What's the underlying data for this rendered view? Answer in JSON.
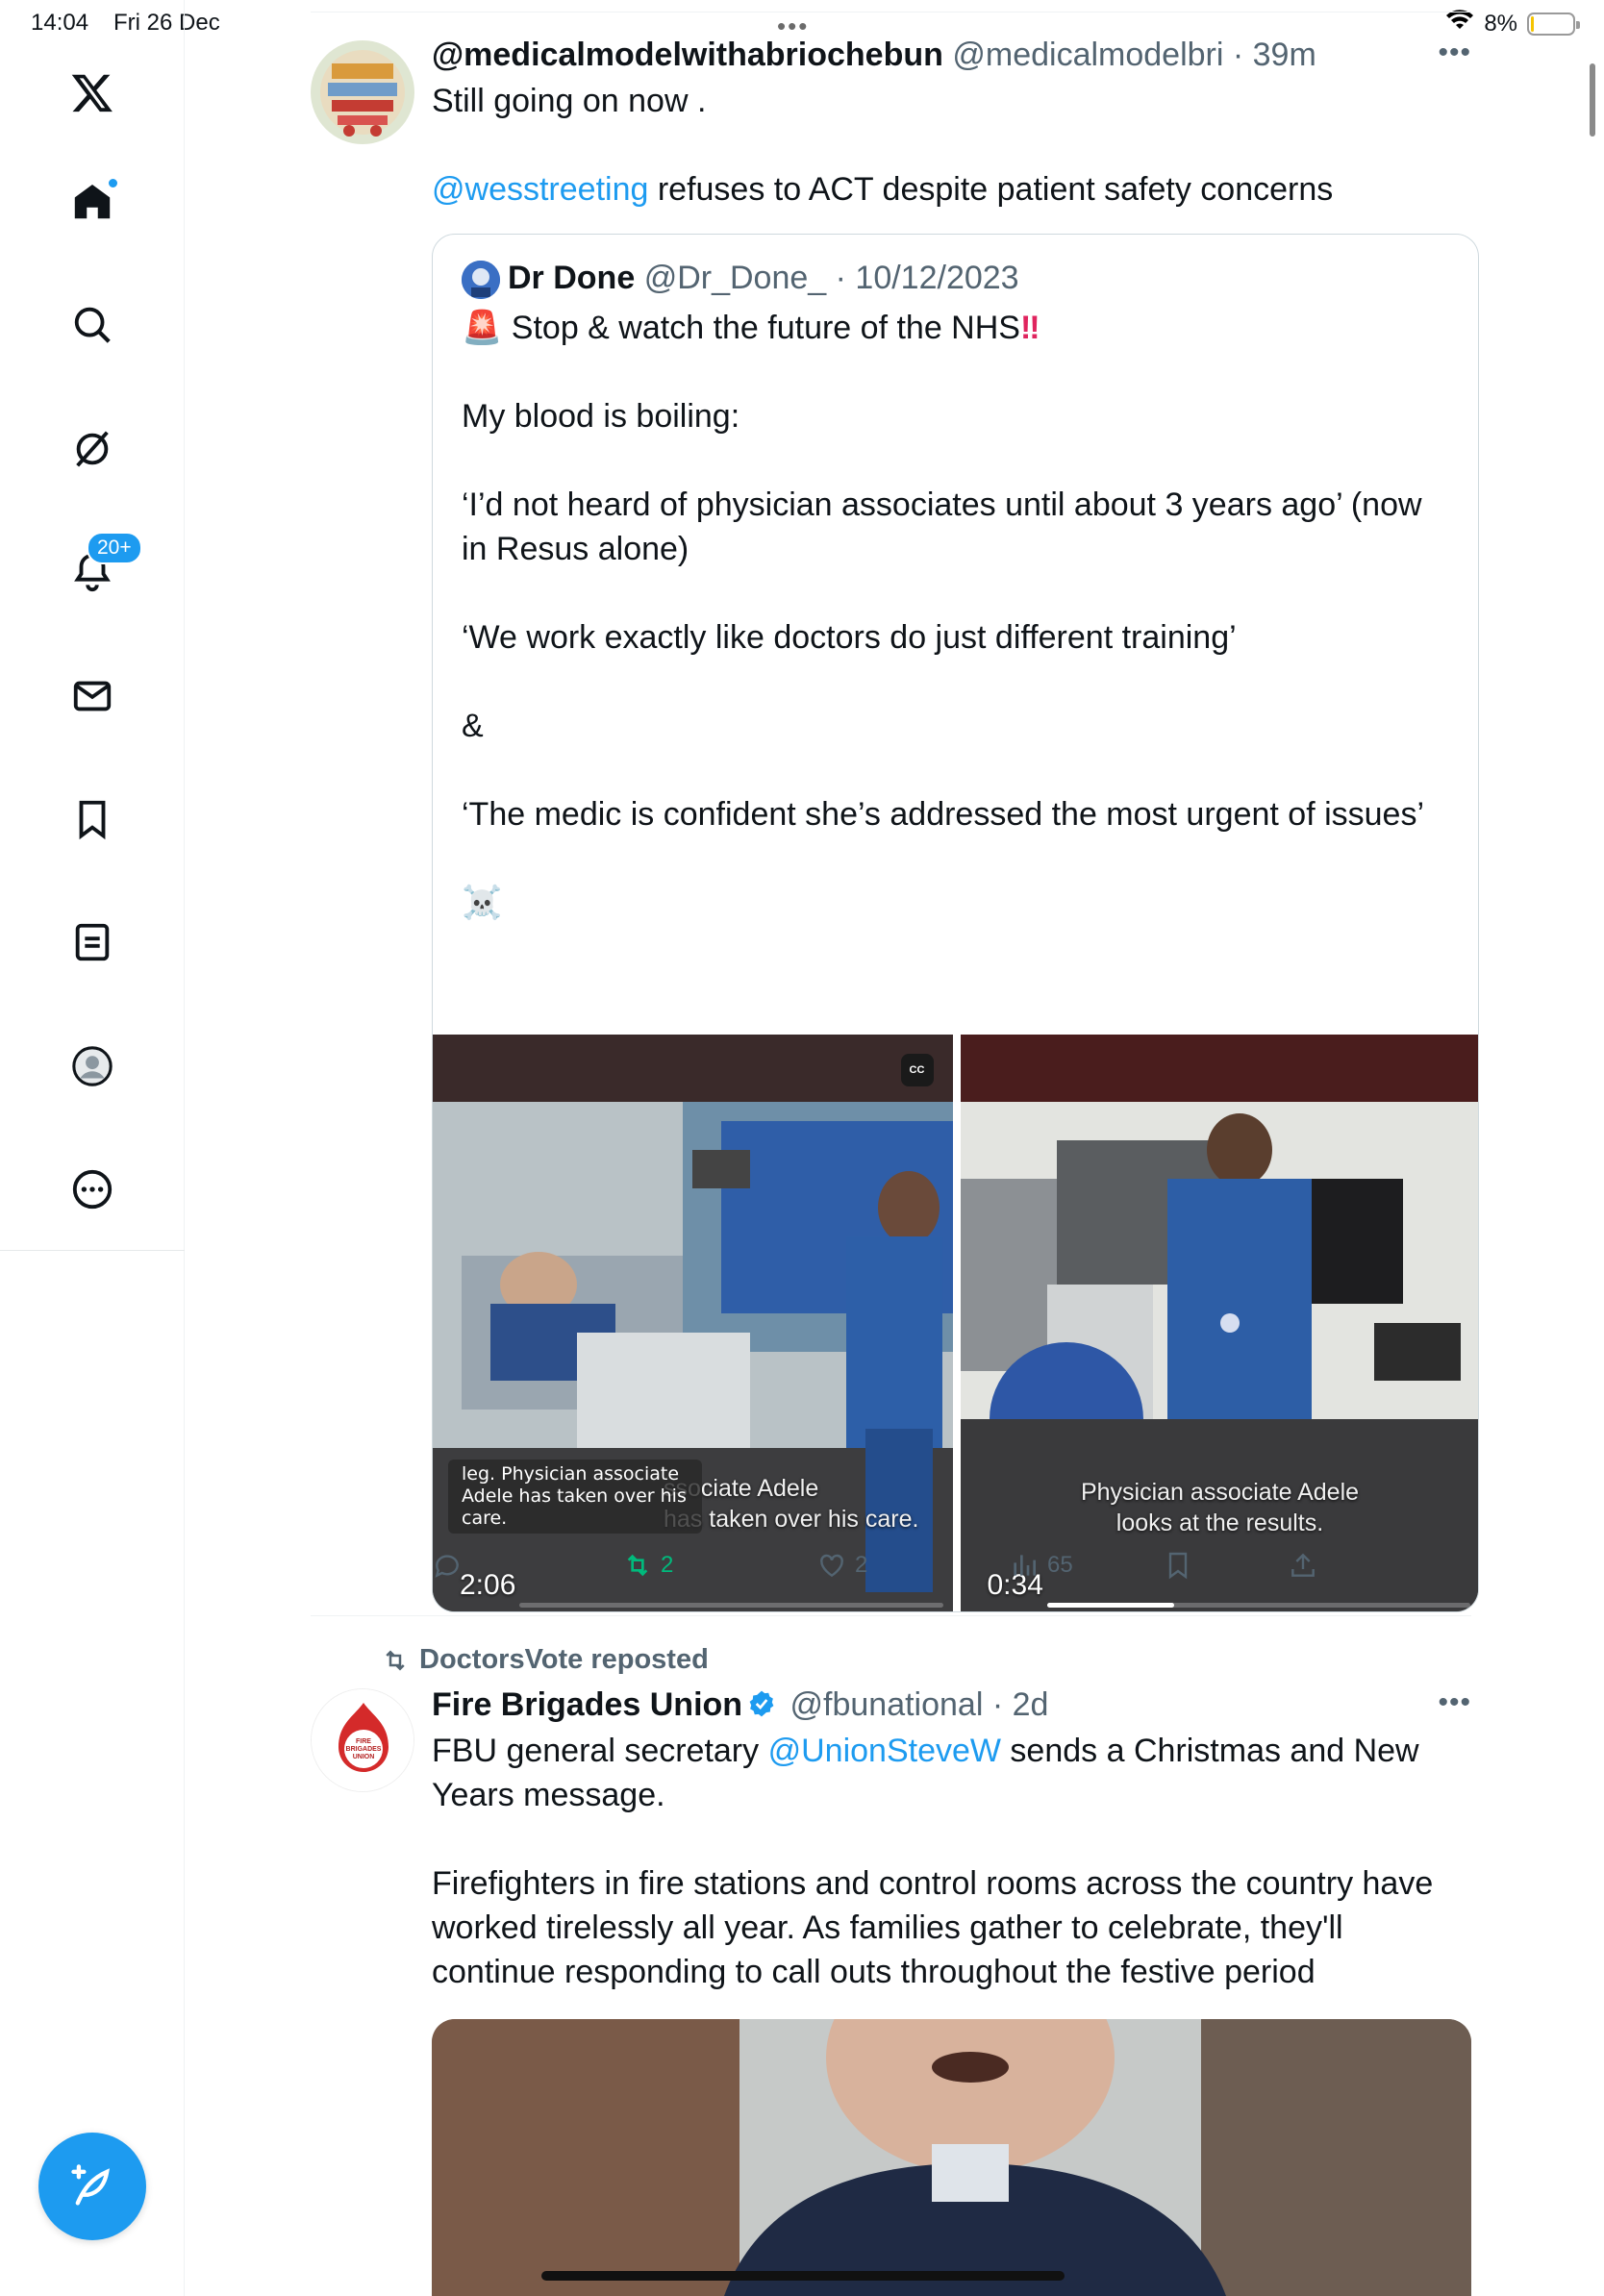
{
  "status": {
    "time": "14:04",
    "date": "Fri 26 Dec",
    "battery": "8%",
    "battery_level": 0.08,
    "multitask_dots": "•••"
  },
  "sidebar": {
    "items": [
      {
        "name": "x-logo-icon"
      },
      {
        "name": "home-icon",
        "has_dot": true
      },
      {
        "name": "search-icon"
      },
      {
        "name": "grok-icon"
      },
      {
        "name": "notifications-icon",
        "badge": "20+"
      },
      {
        "name": "messages-icon"
      },
      {
        "name": "bookmarks-icon"
      },
      {
        "name": "lists-icon"
      },
      {
        "name": "profile-icon"
      },
      {
        "name": "more-icon"
      }
    ],
    "compose_icon": "compose-feather-icon"
  },
  "tweet1": {
    "display_name": "@medicalmodelwithabriochebun",
    "handle": "@medicalmodelbri",
    "time": "· 39m",
    "text_line1": "Still going on now .",
    "mention": "@wesstreeting",
    "text_rest": " refuses to ACT despite patient safety concerns",
    "quote": {
      "name": "Dr Done",
      "handle": "@Dr_Done_",
      "date": "· 10/12/2023",
      "emoji_siren": "🚨",
      "emoji_bang": "‼",
      "line1": " Stop & watch the future of the NHS",
      "text": "My blood is boiling:\n\n‘I’d not heard of physician associates until about 3 years ago’ (now in Resus alone)\n\n‘We work exactly like doctors do just different training’\n\n&\n\n‘The medic is confident she’s addressed the most urgent of issues’\n\n☠️",
      "media": [
        {
          "duration": "2:06",
          "caption": "leg. Physician associate Adele has taken over his care.",
          "burned_sub_1": "ssociate Adele",
          "burned_sub_2": "has taken over his care.",
          "cc": "CC",
          "progress": 0.0
        },
        {
          "duration": "0:34",
          "burned_sub_1": "Physician associate Adele",
          "burned_sub_2": "looks at the results.",
          "progress": 0.3
        }
      ]
    },
    "actions": {
      "reply": "",
      "retweet": "2",
      "like": "2",
      "views": "65"
    },
    "colors": {
      "retweet_active": "#00ba7c",
      "link": "#1d9bf0"
    }
  },
  "tweet2": {
    "repost_by": "DoctorsVote reposted",
    "display_name": "Fire Brigades Union",
    "verified": true,
    "handle": "@fbunational",
    "time": "· 2d",
    "text_prefix": "FBU general secretary ",
    "mention": "@UnionSteveW",
    "text_suffix": " sends a Christmas and New Years message.",
    "text_para2": "Firefighters in fire stations and control rooms across the country have worked tirelessly all year. As families gather to celebrate, they'll continue responding to call outs throughout the festive period",
    "avatar_text": "FIRE BRIGADES UNION"
  }
}
